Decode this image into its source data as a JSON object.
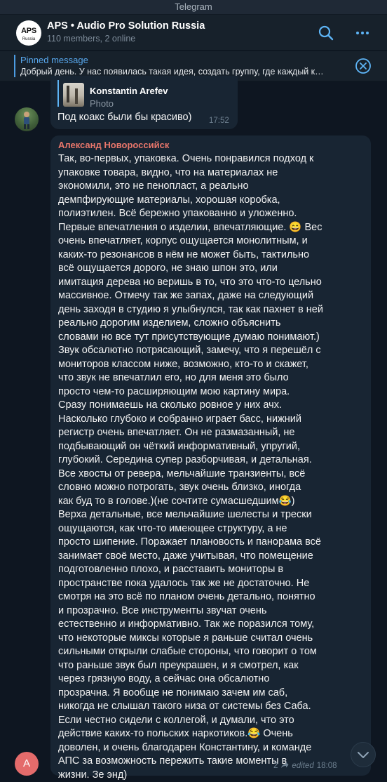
{
  "window": {
    "title": "Telegram"
  },
  "chat": {
    "title": "APS • Audio Pro Solution Russia",
    "subtitle": "110 members, 2 online",
    "logo_text": "APS",
    "logo_sub": "Russia"
  },
  "pinned": {
    "label": "Pinned message",
    "text": "Добрый день. У нас появилась такая идея, создать группу, где каждый к…"
  },
  "icons": {
    "search": "search-icon",
    "more": "more-icon",
    "close": "close-icon",
    "share": "share-icon",
    "scroll_down": "chevron-down-icon"
  },
  "colors": {
    "background": "#0e1621",
    "bubble": "#182533",
    "accent": "#5eb5f7",
    "sender_name": "#e8766b",
    "avatar_a": "#e46b6b"
  },
  "messages": [
    {
      "reply": {
        "name": "Konstantin Arefev",
        "type": "Photo"
      },
      "text": "Под коакс были бы красиво)",
      "time": "17:52"
    },
    {
      "sender": "Александ Новороссийск",
      "avatar_letter": "A",
      "text": "Так, во-первых, упаковка. Очень понравился подход к\nупаковке товара, видно, что на материалах не\nэкономили, это не пенопласт, а реально\nдемпфирующие материалы, хорошая коробка,\nполиэтилен. Всё бережно упакованно и уложенно.\nПервые впечатления о изделии, впечатляющие. 😄 Вес\nочень впечатляет, корпус ощущается монолитным, и\nкаких-то резонансов в нём не может быть, тактильно\nвсё ощущается дорого, не знаю шпон это, или\nимитация дерева но веришь в то, что это что-то цельно\nмассивное. Отмечу так же запах, даже на следующий\nдень заходя в студию я улыбнулся, так как пахнет в ней\nреально дорогим изделием, сложно объяснить\nсловами но все тут присутствующие думаю понимают.)\nЗвук обсалютно потрясающий, замечу, что я перешёл с\nмониторов классом ниже, возможно, кто-то и скажет,\nчто звук не впечатлил его, но для меня это было\nпросто чем-то расширяющим мою картину мира.\nСразу понимаешь на сколько ровное у них ачх.\nНасколько глубоко и собранно играет басс, нижний\nрегистр очень впечатляет. Он не размазанный, не\nподбывающий он чёткий информативный, упругий,\nглубокий. Середина супер разборчивая, и детальная.\nВсе хвосты от ревера, мельчайшие транзиенты, всё\nсловно можно потрогать, звук очень близко, иногда\nкак буд то в голове.)(не сочтите сумасшедшим😂)\nВерха детальные, все мельчайшие шелесты и трески\nощущаются, как что-то имеющее структуру, а не\nпросто шипение. Поражает плановость и панорама всё\nзанимает своё место, даже учитывая, что помещение\nподготовленно плохо, и расставить мониторы в\nпространстве пока удалось так же не достаточно. Не\nсмотря на это всё по планом очень детально, понятно\nи прозрачно. Все инструменты звучат очень\nестественно и информативно. Так же поразился тому,\nчто некоторые миксы которые я раньше считал очень\nсильными открыли слабые стороны,  что говорит о том\nчто раньше звук был преукрашен, и я смотрел, как\nчерез грязную воду, а сейчас она обсалютно\nпрозрачна. Я вообще не понимаю зачем им саб,\nникогда не слышал такого низа от системы без Саба.\nЕсли честно сидели с коллегой, и думали, что это\nдействие каких-то польских наркотиков.😂 Очень\nдоволен, и очень благодарен Константину, и команде\nАПС за возможность пережить такие моменты в\nжизни. Зе энд)",
      "views": "2",
      "edited": "edited",
      "time": "18:08"
    }
  ]
}
